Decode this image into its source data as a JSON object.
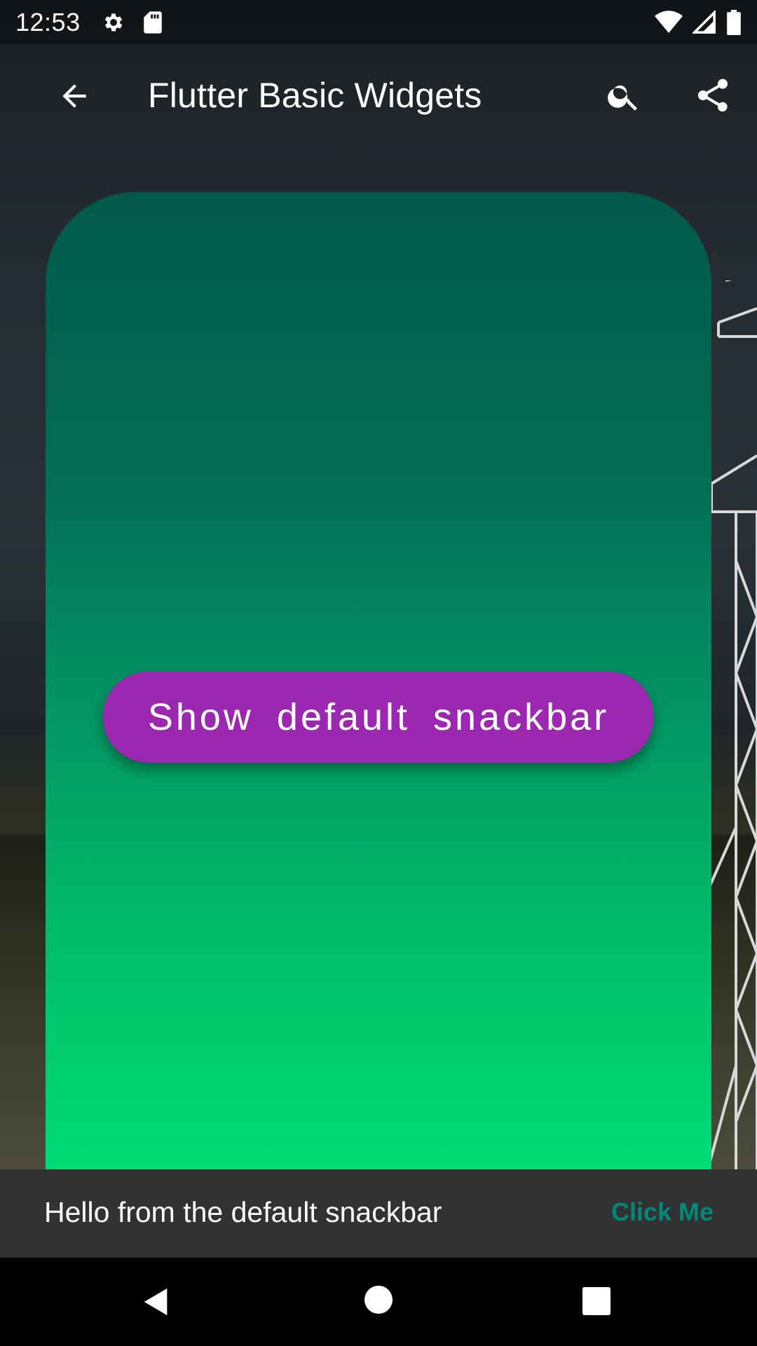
{
  "status_bar": {
    "time": "12:53",
    "left_icons": [
      "settings-icon",
      "sd-card-icon"
    ],
    "right_icons": [
      "wifi-icon",
      "signal-icon",
      "battery-icon"
    ]
  },
  "app_bar": {
    "title": "Flutter Basic Widgets",
    "icons": [
      "arrow-back-icon",
      "search-icon",
      "share-icon"
    ]
  },
  "card": {
    "gradient_top": "#02594a",
    "gradient_bottom": "#00dc75",
    "button_label": "Show default snackbar",
    "button_color": "#9c27b0"
  },
  "snackbar": {
    "message": "Hello from the default snackbar",
    "action_label": "Click Me",
    "action_color": "#00897b",
    "background": "#323232"
  },
  "nav_bar": {
    "icons": [
      "nav-back-icon",
      "nav-home-icon",
      "nav-recents-icon"
    ]
  }
}
